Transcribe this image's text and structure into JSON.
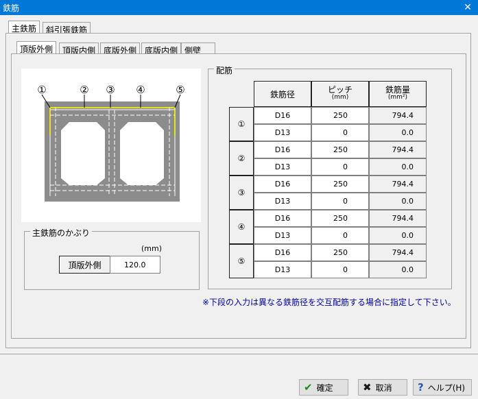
{
  "window": {
    "title": "鉄筋",
    "close_glyph": "✕"
  },
  "outer_tabs": [
    {
      "label": "主鉄筋",
      "active": true
    },
    {
      "label": "斜引張鉄筋",
      "active": false
    }
  ],
  "inner_tabs": [
    {
      "label": "頂版外側",
      "active": true
    },
    {
      "label": "頂版内側",
      "active": false
    },
    {
      "label": "底版外側",
      "active": false
    },
    {
      "label": "底版内側",
      "active": false
    },
    {
      "label": "側壁",
      "active": false
    }
  ],
  "diagram": {
    "labels": [
      "①",
      "②",
      "③",
      "④",
      "⑤"
    ]
  },
  "cover": {
    "group_title": "主鉄筋のかぶり",
    "unit": "(mm)",
    "row_label": "頂版外側",
    "value": "120.0"
  },
  "rebar": {
    "group_title": "配筋",
    "headers": {
      "diameter": "鉄筋径",
      "pitch": "ピッチ",
      "pitch_unit": "(mm)",
      "area": "鉄筋量",
      "area_unit": "(mm²)"
    },
    "groups": [
      {
        "label": "①",
        "rows": [
          {
            "diameter": "D16",
            "pitch": "250",
            "area": "794.4"
          },
          {
            "diameter": "D13",
            "pitch": "0",
            "area": "0.0"
          }
        ]
      },
      {
        "label": "②",
        "rows": [
          {
            "diameter": "D16",
            "pitch": "250",
            "area": "794.4"
          },
          {
            "diameter": "D13",
            "pitch": "0",
            "area": "0.0"
          }
        ]
      },
      {
        "label": "③",
        "rows": [
          {
            "diameter": "D16",
            "pitch": "250",
            "area": "794.4"
          },
          {
            "diameter": "D13",
            "pitch": "0",
            "area": "0.0"
          }
        ]
      },
      {
        "label": "④",
        "rows": [
          {
            "diameter": "D16",
            "pitch": "250",
            "area": "794.4"
          },
          {
            "diameter": "D13",
            "pitch": "0",
            "area": "0.0"
          }
        ]
      },
      {
        "label": "⑤",
        "rows": [
          {
            "diameter": "D16",
            "pitch": "250",
            "area": "794.4"
          },
          {
            "diameter": "D13",
            "pitch": "0",
            "area": "0.0"
          }
        ]
      }
    ]
  },
  "note": "※下段の入力は異なる鉄筋径を交互配筋する場合に指定して下さい。",
  "buttons": {
    "ok": {
      "label": "確定",
      "icon": "check-icon",
      "glyph": "✔",
      "color": "#1a8a1a"
    },
    "cancel": {
      "label": "取消",
      "icon": "cross-icon",
      "glyph": "✖",
      "color": "#1a1a1a"
    },
    "help": {
      "label": "ヘルプ(H)",
      "icon": "question-icon",
      "glyph": "?",
      "color": "#1e5bb8"
    }
  }
}
